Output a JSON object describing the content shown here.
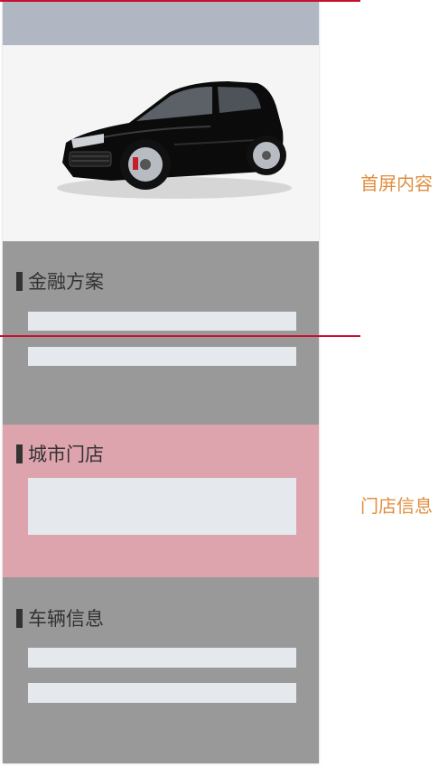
{
  "sections": {
    "finance": {
      "title": "金融方案"
    },
    "store": {
      "title": "城市门店"
    },
    "vehicle": {
      "title": "车辆信息"
    }
  },
  "annotations": {
    "first_screen": "首屏内容",
    "store_info": "门店信息"
  },
  "colors": {
    "page_background": "#999999",
    "top_bar": "#b0b7c3",
    "hero_background": "#f5f5f5",
    "placeholder": "#e5e9ee",
    "store_highlight": "#dea4ae",
    "fold_line": "#c8102e",
    "annotation_text": "#e08e3f",
    "title_text": "#333333"
  },
  "icons": {
    "hero": "car-image"
  }
}
